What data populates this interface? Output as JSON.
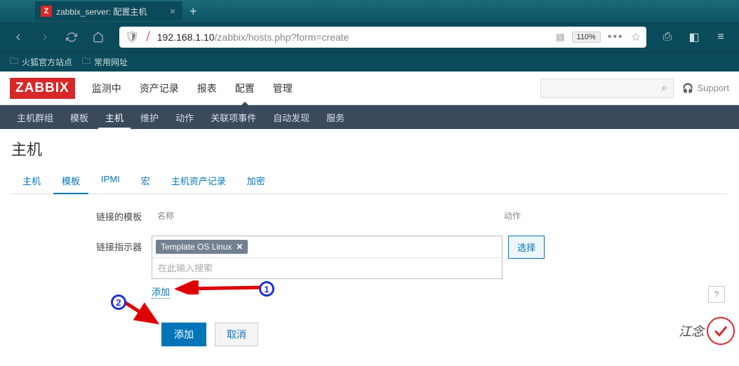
{
  "browser": {
    "tab_title": "zabbix_server: 配置主机",
    "tab_fav": "Z",
    "url_secure": "192.168.1.10",
    "url_path": "/zabbix/hosts.php?form=create",
    "zoom": "110%",
    "bookmarks": [
      "火狐官方站点",
      "常用网址"
    ]
  },
  "app": {
    "logo": "ZABBIX",
    "top_nav": [
      "监测中",
      "资产记录",
      "报表",
      "配置",
      "管理"
    ],
    "top_nav_active": "配置",
    "support": "Support",
    "sub_nav": [
      "主机群组",
      "模板",
      "主机",
      "维护",
      "动作",
      "关联项事件",
      "自动发现",
      "服务"
    ],
    "sub_nav_active": "主机",
    "page_title": "主机",
    "form_tabs": [
      "主机",
      "模板",
      "IPMI",
      "宏",
      "主机资产记录",
      "加密"
    ],
    "form_tab_active": "模板",
    "linked_label": "链接的模板",
    "linked_col_name": "名称",
    "linked_col_action": "动作",
    "linker_label": "链接指示器",
    "template_tag": "Template OS Linux",
    "search_placeholder": "在此输入搜索",
    "select_btn": "选择",
    "add_link": "添加",
    "submit_btn": "添加",
    "cancel_btn": "取消"
  },
  "annotations": {
    "num1": "1",
    "num2": "2",
    "page_num": "?",
    "watermark": "江念"
  }
}
